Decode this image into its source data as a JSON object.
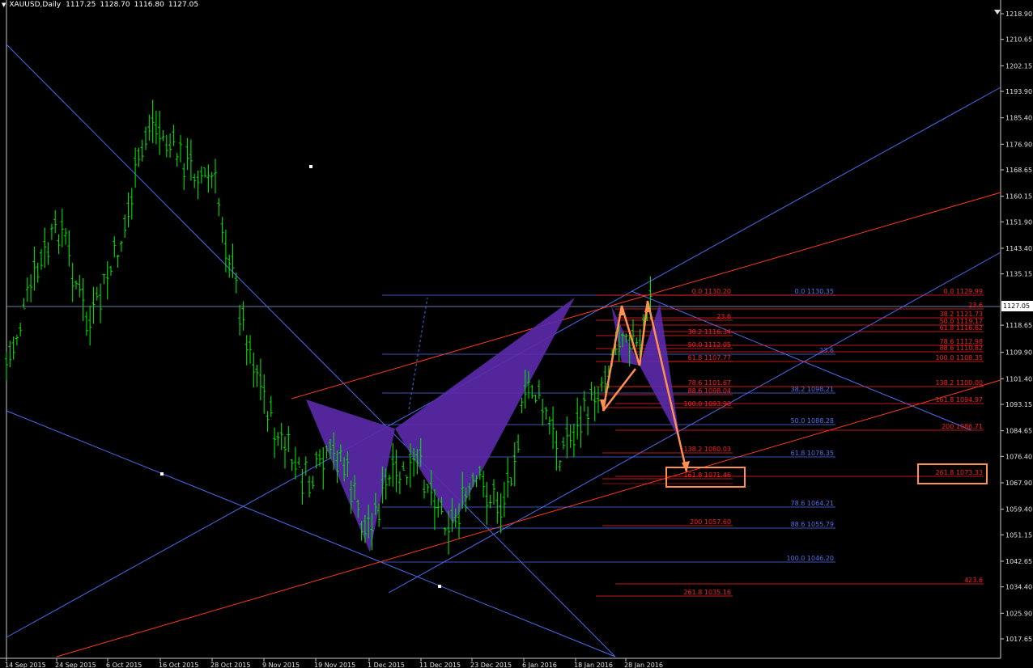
{
  "header": {
    "symbol": "XAUUSD,Daily",
    "ohlc": [
      "1117.25",
      "1128.70",
      "1116.80",
      "1127.05"
    ]
  },
  "current_price": "1127.05",
  "price_axis": [
    "1218.90",
    "1210.65",
    "1202.15",
    "1193.90",
    "1185.40",
    "1176.90",
    "1168.65",
    "1160.15",
    "1151.90",
    "1143.40",
    "1135.15",
    "1118.65",
    "1109.90",
    "1101.40",
    "1093.15",
    "1084.65",
    "1076.40",
    "1067.90",
    "1059.40",
    "1051.15",
    "1042.65",
    "1034.40",
    "1025.90",
    "1017.65"
  ],
  "time_axis": [
    "14 Sep 2015",
    "24 Sep 2015",
    "6 Oct 2015",
    "16 Oct 2015",
    "28 Oct 2015",
    "9 Nov 2015",
    "19 Nov 2015",
    "1 Dec 2015",
    "11 Dec 2015",
    "23 Dec 2015",
    "6 Jan 2016",
    "18 Jan 2016",
    "28 Jan 2016"
  ],
  "fibo_blue": [
    "0.0 1130.35",
    "23.6",
    "38.2 1098.21",
    "50.0 1088.28",
    "61.8 1078.35",
    "78.6 1064.21",
    "88.6 1055.79",
    "100.0 1046.20"
  ],
  "fibo_red_mid": [
    "0.0 1130.20",
    "23.6",
    "38.2 1116.34",
    "50.0 1112.05",
    "61.8 1107.77",
    "78.6 1101.67",
    "88.6 1098.04",
    "100.0 1093.90",
    "138.2 1080.03",
    "161.8 1071.46",
    "200 1057.60",
    "261.8 1035.16"
  ],
  "fibo_red_right": [
    "0.0 1129.99",
    "23.6",
    "38.2 1121.73",
    "50.0 1119.17",
    "61.8 1116.62",
    "78.6 1112.98",
    "88.6 1110.82",
    "100.0 1108.35",
    "138.2 1100.00",
    "161.8 1094.97",
    "200 1086.71",
    "261.8 1073.33",
    "423.6"
  ],
  "colors": {
    "background": "#000000",
    "bars": "#00e000",
    "channel": "#4a6cf0",
    "trendline_red": "#ff3a1a",
    "fibo_red": "#ff2020",
    "fibo_blue": "#5070f0",
    "harmonic_fill": "#5a2aa8",
    "pattern_orange": "#ff9050"
  }
}
